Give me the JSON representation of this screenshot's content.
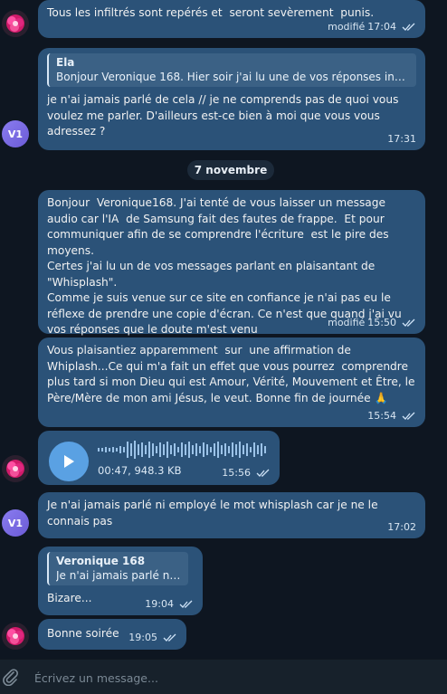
{
  "messages": {
    "m1": {
      "text": "Tous les infiltrés sont repérés et  seront sevèrement  punis.",
      "edited": "modifié",
      "time": "17:04"
    },
    "m2": {
      "reply_name": "Ela",
      "reply_text": "Bonjour Veronique 168. Hier soir j'ai  lu une de vos  réponses incl...",
      "text": "je n'ai jamais parlé de cela // je ne comprends pas de quoi vous voulez me parler. D'ailleurs est-ce bien à moi que vous vous adressez ?",
      "time": "17:31"
    },
    "date_separator": "7 novembre",
    "m3": {
      "text": "Bonjour  Veronique168. J'ai tenté de vous laisser un message audio car l'IA  de Samsung fait des fautes de frappe.  Et pour communiquer afin de se comprendre l'écriture  est le pire des moyens.\nCertes j'ai lu un de vos messages parlant en plaisantant de \"Whisplash\".\nComme je suis venue sur ce site en confiance je n'ai pas eu le réflexe de prendre une copie d'écran. Ce n'est que quand j'ai vu vos réponses que le doute m'est venu",
      "edited": "modifié",
      "time": "15:50"
    },
    "m4": {
      "text": "Vous plaisantiez apparemment  sur  une affirmation de Whiplash...Ce qui m'a fait un effet que vous pourrez  comprendre plus tard si mon Dieu qui est Amour, Vérité, Mouvement et Être, le Père/Mère de mon ami Jésus, le veut. Bonne fin de journée 🙏",
      "time": "15:54"
    },
    "m5_voice": {
      "duration": "00:47",
      "size": "948.3 KB",
      "time": "15:56"
    },
    "m6": {
      "text": "Je n'ai jamais parlé ni employé le mot whisplash car je ne le connais pas",
      "time": "17:02"
    },
    "m7": {
      "reply_name": "Veronique 168",
      "reply_text": "Je n'ai jamais parlé ni e...",
      "text": "Bizare...",
      "time": "19:04"
    },
    "m8": {
      "text": "Bonne soirée",
      "time": "19:05"
    }
  },
  "avatars": {
    "v1_initials": "V1"
  },
  "composer": {
    "placeholder": "Écrivez un message..."
  },
  "colors": {
    "bubble": "#2b5278",
    "background": "#0e1621",
    "accent": "#5aa1e3"
  },
  "icons": {
    "attach": "paperclip-icon",
    "play": "play-icon",
    "read": "double-check-icon"
  }
}
